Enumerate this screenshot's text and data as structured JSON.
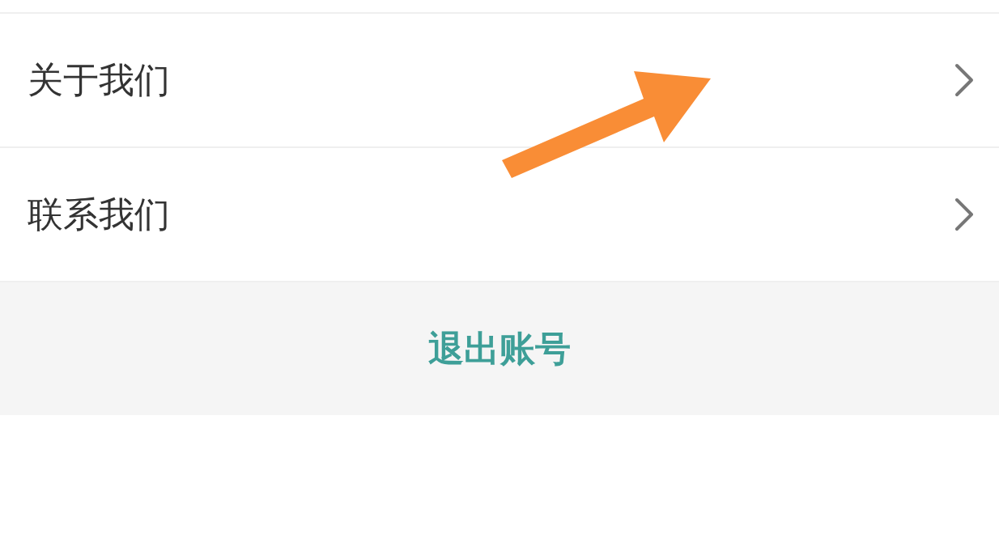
{
  "menu_items": [
    {
      "label": "关于我们"
    },
    {
      "label": "联系我们"
    }
  ],
  "logout_button": {
    "label": "退出账号"
  }
}
